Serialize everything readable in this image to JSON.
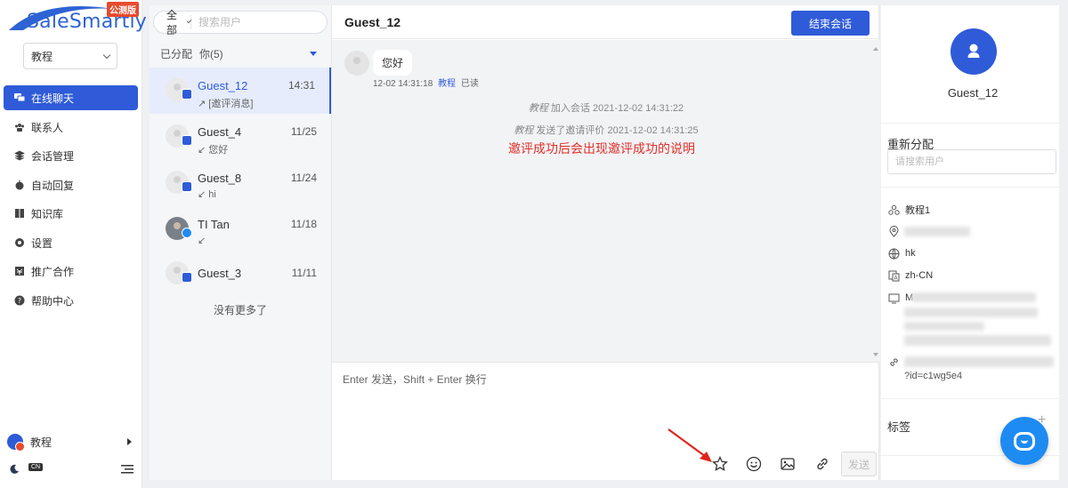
{
  "brand": {
    "logo_text": "SaleSmartly",
    "badge": "公测版"
  },
  "workspace": {
    "selected": "教程"
  },
  "nav": {
    "items": [
      {
        "label": "在线聊天",
        "icon": "chat-icon",
        "active": true
      },
      {
        "label": "联系人",
        "icon": "contacts-icon"
      },
      {
        "label": "会话管理",
        "icon": "layers-icon"
      },
      {
        "label": "自动回复",
        "icon": "robot-icon"
      },
      {
        "label": "知识库",
        "icon": "book-icon"
      },
      {
        "label": "设置",
        "icon": "gear-icon"
      },
      {
        "label": "推广合作",
        "icon": "promotion-icon"
      },
      {
        "label": "帮助中心",
        "icon": "help-icon"
      }
    ],
    "user_label": "教程",
    "lang_badge": "CN"
  },
  "conversations": {
    "filter": "全部",
    "search_placeholder": "搜索用户",
    "group_label": "已分配",
    "group_count": "你(5)",
    "items": [
      {
        "name": "Guest_12",
        "time": "14:31",
        "preview": "↗ [邀评消息]",
        "active": true,
        "channel": "chat"
      },
      {
        "name": "Guest_4",
        "time": "11/25",
        "preview": "↙ 您好",
        "channel": "chat"
      },
      {
        "name": "Guest_8",
        "time": "11/24",
        "preview": "↙ hi",
        "channel": "chat"
      },
      {
        "name": "TI Tan",
        "time": "11/18",
        "preview": "↙",
        "channel": "messenger"
      },
      {
        "name": "Guest_3",
        "time": "11/11",
        "preview": "",
        "channel": "chat"
      }
    ],
    "no_more": "没有更多了"
  },
  "chat": {
    "title": "Guest_12",
    "end_button": "结束会话",
    "message": {
      "text": "您好",
      "time": "12-02 14:31:18",
      "agent": "教程",
      "status": "已读"
    },
    "system": [
      {
        "actor": "教程",
        "text": " 加入会话 2021-12-02 14:31:22"
      },
      {
        "actor": "教程",
        "text": " 发送了邀请评价 2021-12-02 14:31:25"
      }
    ],
    "annotation": "邀评成功后会出现邀评成功的说明",
    "input_placeholder": "Enter 发送，Shift + Enter 换行",
    "send_button": "发送"
  },
  "info": {
    "name": "Guest_12",
    "reassign_label": "重新分配",
    "reassign_placeholder": "请搜索用户",
    "rows": [
      {
        "icon": "team-icon",
        "value": "教程1"
      },
      {
        "icon": "location-icon",
        "value": ""
      },
      {
        "icon": "globe-icon",
        "value": "hk"
      },
      {
        "icon": "language-icon",
        "value": "zh-CN"
      },
      {
        "icon": "device-icon",
        "value": "M"
      }
    ],
    "url_tail": "?id=c1wg5e4",
    "tags_label": "标签"
  },
  "colors": {
    "primary": "#2f5bd8",
    "annotation": "#e0312b",
    "badge": "#e64b2e"
  }
}
